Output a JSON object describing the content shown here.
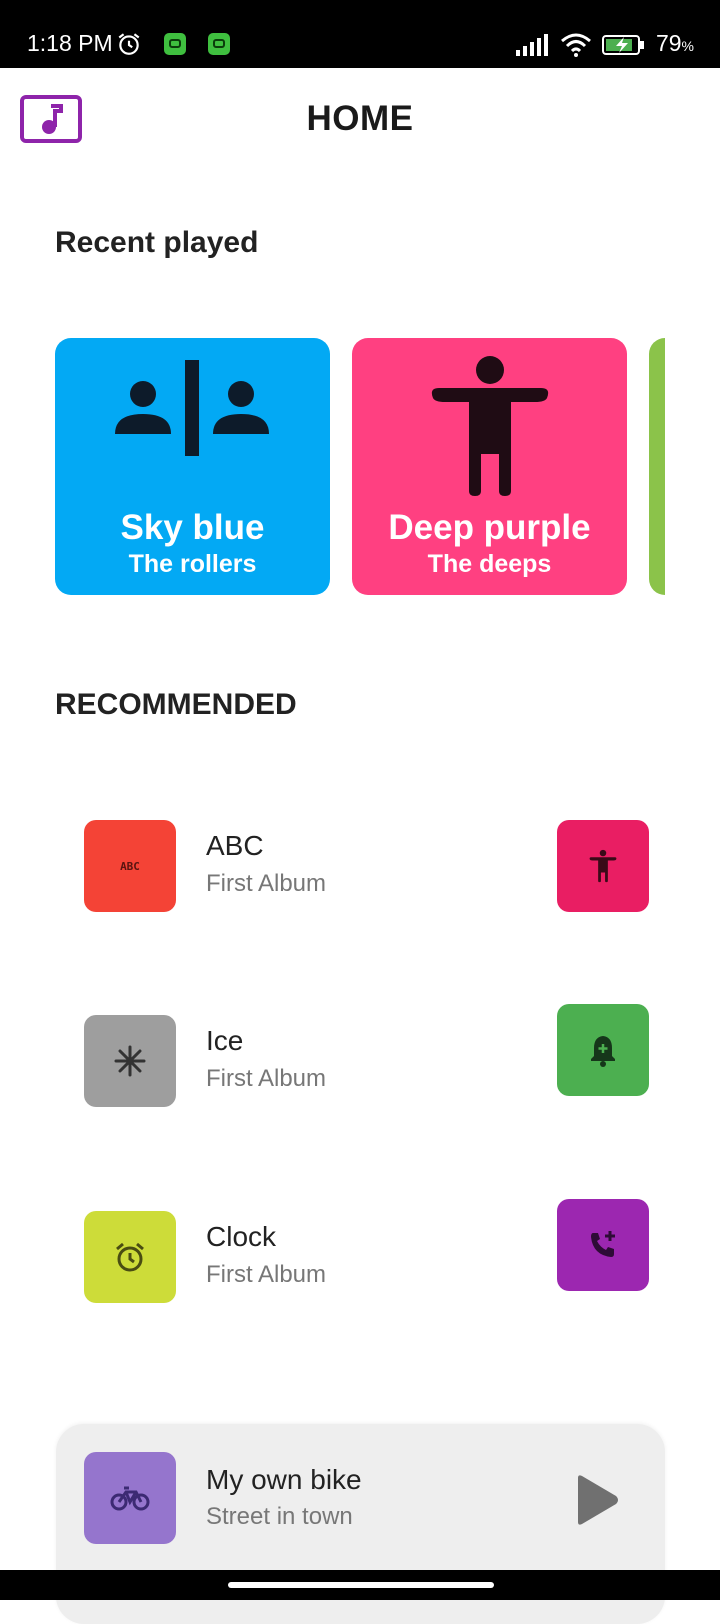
{
  "status_bar": {
    "time": "1:18 PM",
    "battery_percent": "79",
    "battery_unit": "%"
  },
  "app_bar": {
    "title": "HOME",
    "logo_icon": "music-note-icon",
    "accent": "#8e24aa"
  },
  "recent": {
    "heading": "Recent played",
    "cards": [
      {
        "title": "Sky blue",
        "artist": "The rollers",
        "color": "#03a9f4",
        "icon": "people-divider-icon"
      },
      {
        "title": "Deep purple",
        "artist": "The deeps",
        "color": "#ff4081",
        "icon": "accessibility-icon"
      },
      {
        "title": "",
        "artist": "",
        "color": "#8bc34a",
        "icon": ""
      }
    ]
  },
  "recommended": {
    "heading": "RECOMMENDED",
    "items": [
      {
        "name": "ABC",
        "album": "First Album",
        "color": "#f44336",
        "icon": "abc-icon",
        "side_color": "#e91e63",
        "side_icon": "accessibility-icon"
      },
      {
        "name": "Ice",
        "album": "First Album",
        "color": "#9e9e9e",
        "icon": "snowflake-icon",
        "side_color": "#4caf50",
        "side_icon": "notification-add-icon"
      },
      {
        "name": "Clock",
        "album": "First Album",
        "color": "#cddc39",
        "icon": "alarm-icon",
        "side_color": "#9c27b0",
        "side_icon": "add-call-icon"
      }
    ]
  },
  "now_playing": {
    "title": "My own bike",
    "subtitle": "Street in town",
    "thumb_color": "#9575cd",
    "thumb_icon": "bike-icon",
    "play_icon": "play-icon"
  }
}
